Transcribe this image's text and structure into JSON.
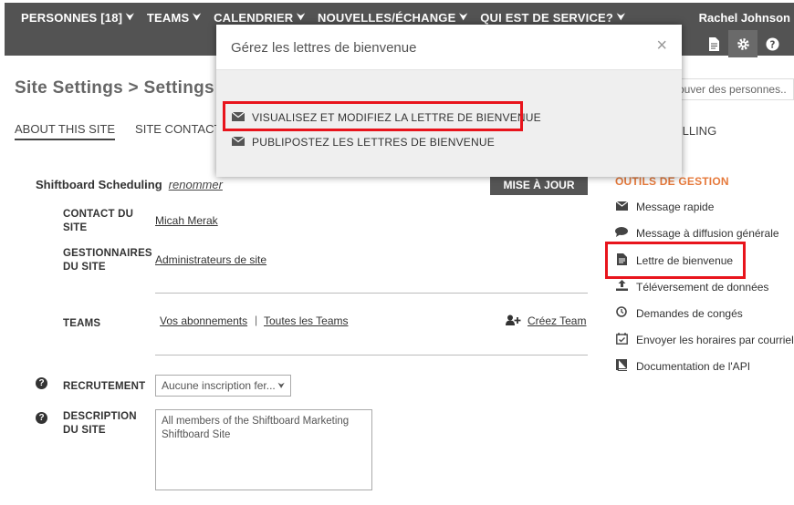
{
  "nav": {
    "items": [
      {
        "label": "PERSONNES [18]"
      },
      {
        "label": "TEAMS"
      },
      {
        "label": "CALENDRIER"
      },
      {
        "label": "NOUVELLES/ÉCHANGE"
      },
      {
        "label": "QUI EST DE SERVICE?"
      }
    ],
    "user_name": "Rachel Johnson",
    "icons": [
      "document-icon",
      "gear-icon",
      "help-icon"
    ]
  },
  "page": {
    "title": "Site Settings > Settings",
    "search_placeholder": "ouver des personnes..",
    "tabs": [
      {
        "label": "ABOUT THIS SITE",
        "active": true
      },
      {
        "label": "SITE CONTACT",
        "active": false
      }
    ],
    "billing_tab": "ILLING"
  },
  "site": {
    "name": "Shiftboard Scheduling",
    "rename_label": "renommer",
    "update_button": "MISE À JOUR",
    "contact_label": "CONTACT DU SITE",
    "contact_value": "Micah Merak",
    "managers_label": "GESTIONNAIRES DU SITE",
    "managers_value": "Administrateurs de site",
    "teams_label": "TEAMS",
    "teams_links": [
      "Vos abonnements",
      "Toutes les Teams"
    ],
    "teams_separator": "|",
    "create_team": "Créez Team",
    "recruitment_label": "RECRUTEMENT",
    "recruitment_value": "Aucune inscription fer...",
    "description_label": "DESCRIPTION DU SITE",
    "description_value": "All members of the Shiftboard Marketing Shiftboard Site"
  },
  "tools": {
    "heading": "OUTILS DE GESTION",
    "items": [
      {
        "label": "Message rapide",
        "icon": "envelope-icon"
      },
      {
        "label": "Message à diffusion générale",
        "icon": "speech-bubble-icon"
      },
      {
        "label": "Lettre de bienvenue",
        "icon": "document-icon"
      },
      {
        "label": "Téléversement de données",
        "icon": "upload-icon"
      },
      {
        "label": "Demandes de congés",
        "icon": "clock-icon"
      },
      {
        "label": "Envoyer les horaires par courriel",
        "icon": "calendar-check-icon"
      },
      {
        "label": "Documentation de l'API",
        "icon": "book-icon"
      }
    ]
  },
  "modal": {
    "title": "Gérez les lettres de bienvenue",
    "close_symbol": "×",
    "options": [
      {
        "label": "VISUALISEZ ET MODIFIEZ LA LETTRE DE BIENVENUE",
        "icon": "envelope-icon"
      },
      {
        "label": "PUBLIPOSTEZ LES LETTRES DE BIENVENUE",
        "icon": "envelope-icon"
      }
    ]
  },
  "colors": {
    "topbar": "#535353",
    "highlight": "#e8141c",
    "tools_heading": "#e67a3c"
  }
}
